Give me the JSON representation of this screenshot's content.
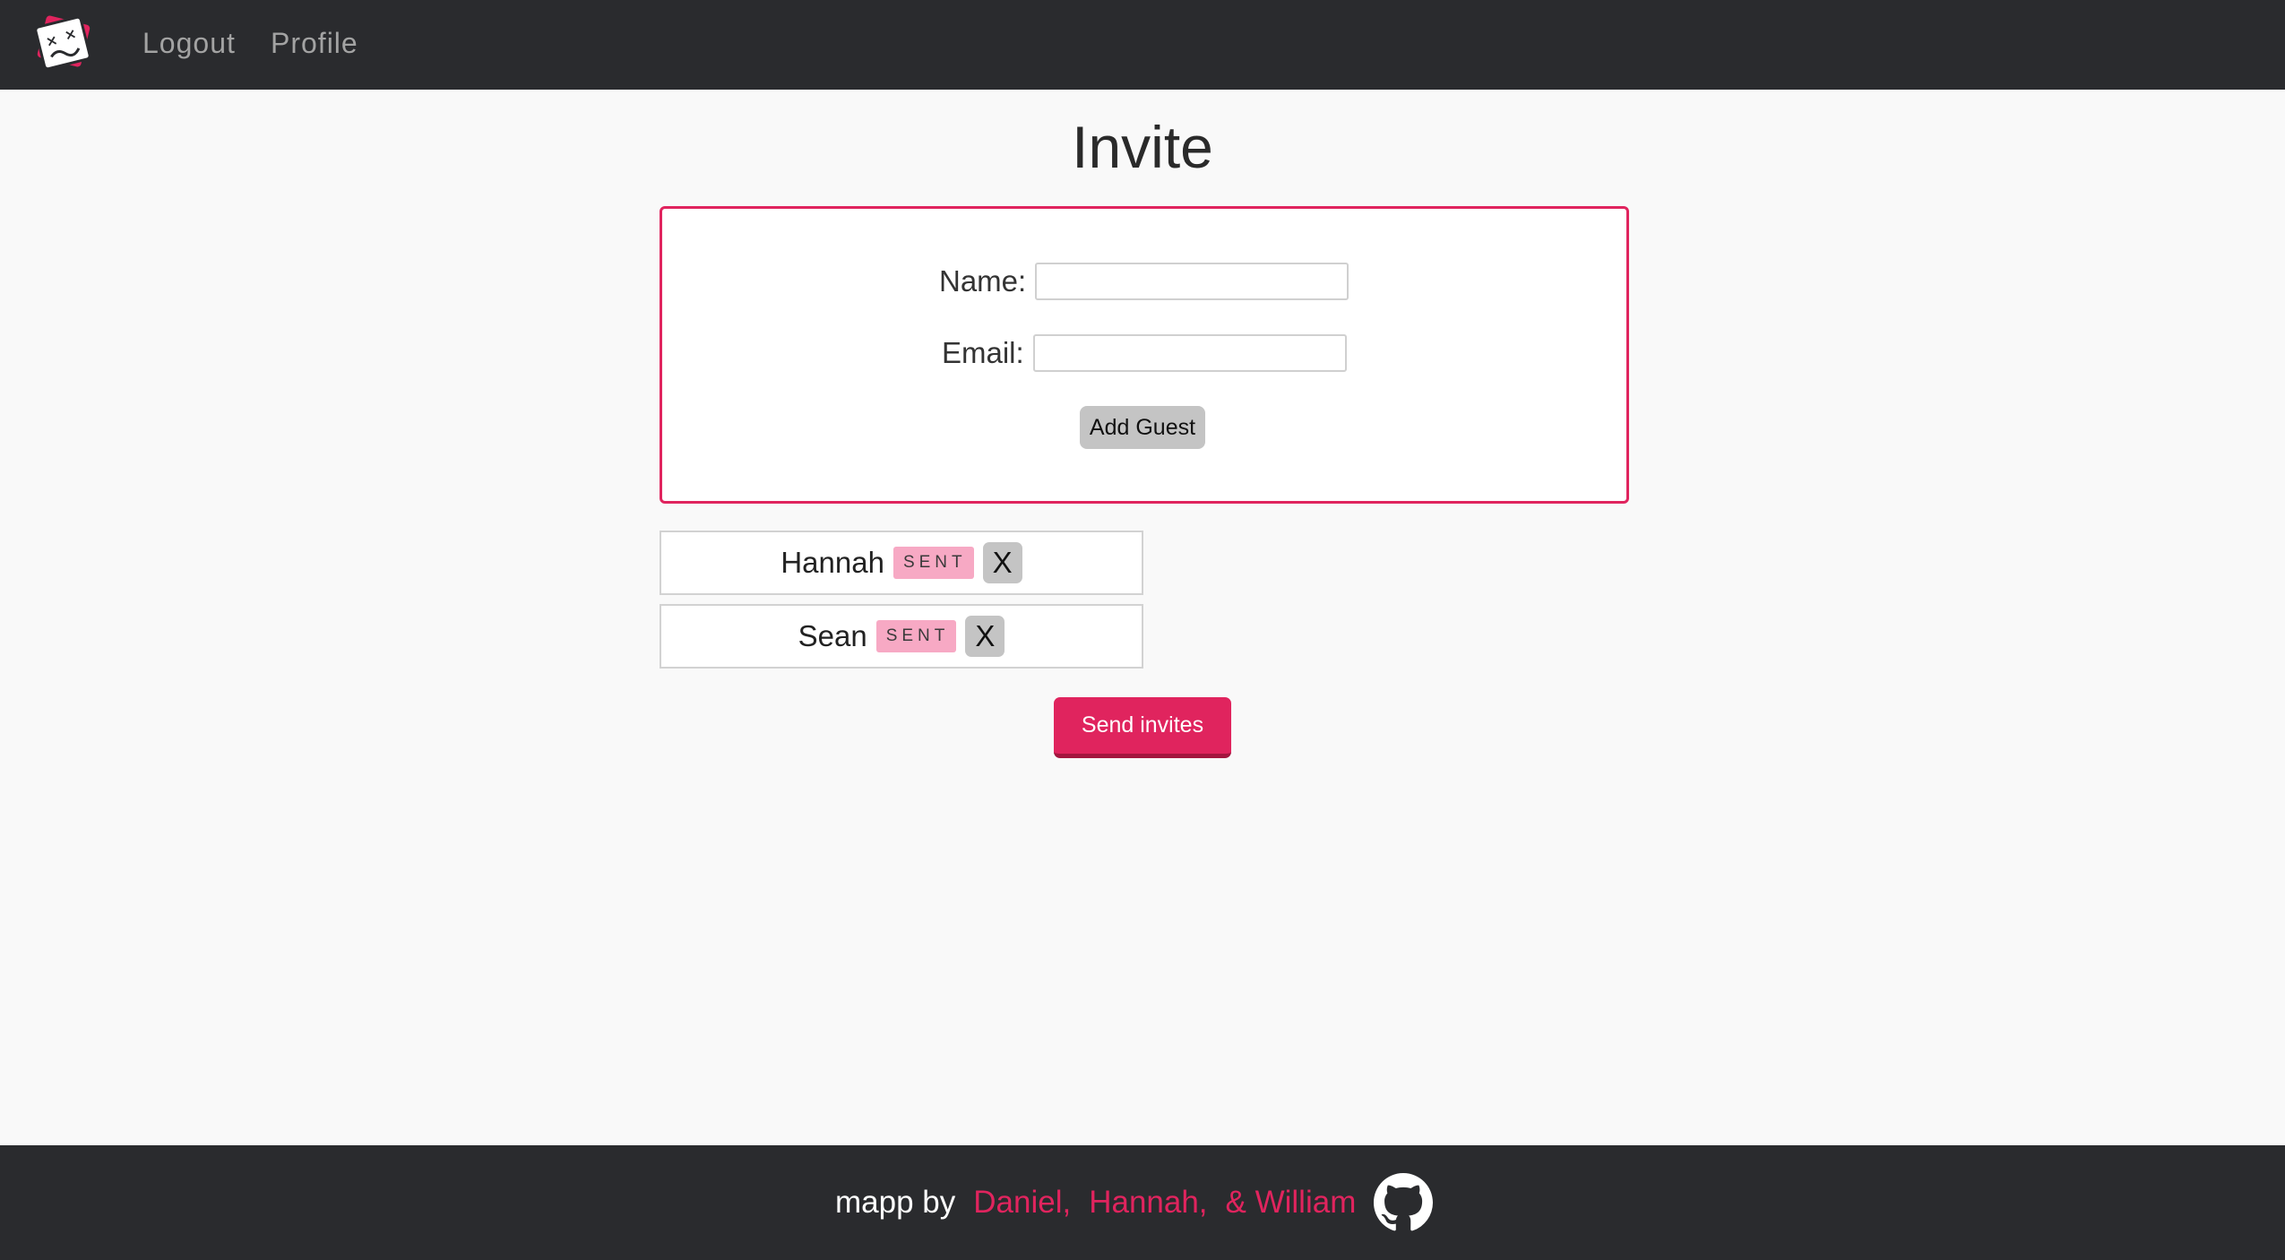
{
  "nav": {
    "logo_icon": "dizzy-face-card-logo-icon",
    "logout_label": "Logout",
    "profile_label": "Profile"
  },
  "page": {
    "title": "Invite"
  },
  "invite_form": {
    "name_label": "Name:",
    "name_value": "",
    "email_label": "Email:",
    "email_value": "",
    "add_guest_label": "Add Guest"
  },
  "guests": [
    {
      "name": "Hannah",
      "status": "SENT",
      "remove_label": "X"
    },
    {
      "name": "Sean",
      "status": "SENT",
      "remove_label": "X"
    }
  ],
  "send_invites_label": "Send invites",
  "footer": {
    "prefix": "mapp by",
    "authors": [
      "Daniel,",
      "Hannah,",
      "& William"
    ],
    "github_icon": "github-icon"
  },
  "colors": {
    "accent": "#e0245e",
    "navbar_bg": "#2a2b2e",
    "badge_bg": "#f7a9c4",
    "button_gray": "#c4c4c4",
    "page_bg": "#f9f9f9"
  }
}
